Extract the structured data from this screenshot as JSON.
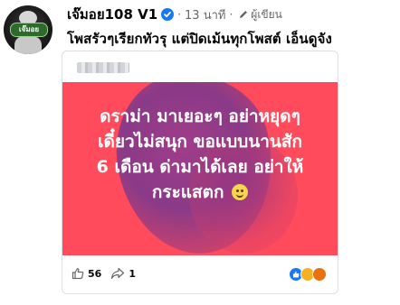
{
  "post": {
    "author": "เจ๊มอย108 V1",
    "time": "13 นาที",
    "separator": "·",
    "role": "ผู้เขียน",
    "text": "โพสรัวๆเรียกทัวรุ แต่ปิดเม้นทุกโพสต์ เอ็นดูจัง",
    "avatar_badge": "เจ๊มอย"
  },
  "shared_card": {
    "quote_lines": [
      "ดราม่า มาเยอะๆ อย่าหยุดๆ",
      "เดี๋ยวไม่สนุก ขอแบบนานสัก",
      "6 เดือน ด่ามาได้เลย อย่าให้",
      "กระแสตก"
    ],
    "likes": "56",
    "shares": "1",
    "icons": {
      "like": "thumbs-up-icon",
      "share": "share-arrow-icon",
      "emoji": "smile-emoji-icon"
    },
    "colors": {
      "background": "#ff4b5c",
      "blob": "#8a3a88",
      "text": "#ffffff"
    }
  }
}
